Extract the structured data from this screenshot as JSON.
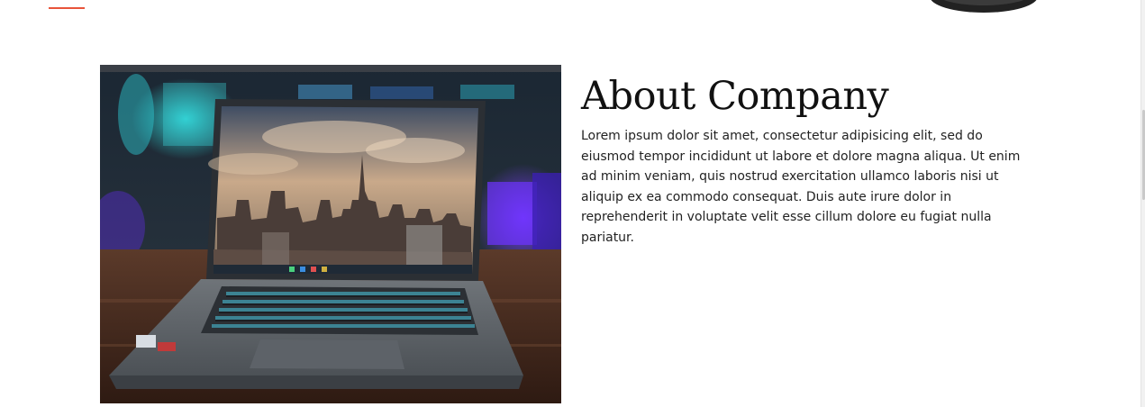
{
  "about": {
    "title": "About Company",
    "body": "Lorem ipsum dolor sit amet, consectetur adipisicing elit, sed do eiusmod tempor incididunt ut labore et dolore magna aliqua. Ut enim ad minim veniam, quis nostrud exercitation ullamco laboris nisi ut aliquip ex ea commodo consequat. Duis aute irure dolor in reprehenderit in voluptate velit esse cillum dolore eu fugiat nulla pariatur."
  },
  "colors": {
    "accent": "#e8543a",
    "title": "#111111",
    "text": "#222222"
  },
  "icons": {
    "photo": "laptop-photo"
  }
}
